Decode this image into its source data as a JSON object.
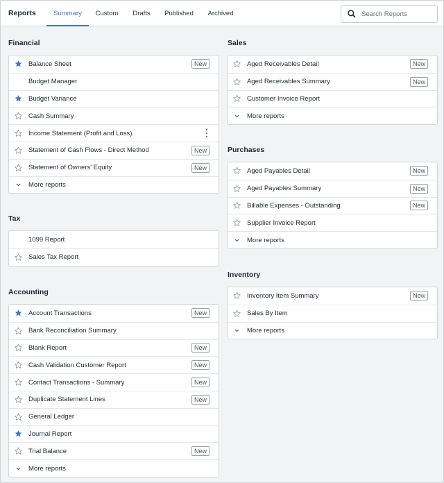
{
  "app": {
    "title": "Reports"
  },
  "tabs": [
    {
      "label": "Summary",
      "active": true
    },
    {
      "label": "Custom",
      "active": false
    },
    {
      "label": "Drafts",
      "active": false
    },
    {
      "label": "Published",
      "active": false
    },
    {
      "label": "Archived",
      "active": false
    }
  ],
  "search": {
    "placeholder": "Search Reports",
    "value": "",
    "icon": "search-icon"
  },
  "colors": {
    "accent": "#3b78c2",
    "star_filled": "#3b78c2",
    "star_outline": "#8a929b"
  },
  "badge_label": "New",
  "sections": {
    "financial": {
      "title": "Financial",
      "items": [
        {
          "label": "Balance Sheet",
          "star": "filled",
          "badge": true
        },
        {
          "label": "Budget Manager",
          "star": "none",
          "badge": false
        },
        {
          "label": "Budget Variance",
          "star": "filled",
          "badge": false
        },
        {
          "label": "Cash Summary",
          "star": "outline",
          "badge": false
        },
        {
          "label": "Income Statement (Profit and Loss)",
          "star": "outline",
          "badge": false,
          "menu": true
        },
        {
          "label": "Statement of Cash Flows - Direct Method",
          "star": "outline",
          "badge": true
        },
        {
          "label": "Statement of Owners' Equity",
          "star": "outline",
          "badge": true
        },
        {
          "label": "More reports",
          "type": "more"
        }
      ]
    },
    "tax": {
      "title": "Tax",
      "items": [
        {
          "label": "1099 Report",
          "star": "none",
          "badge": false
        },
        {
          "label": "Sales Tax Report",
          "star": "outline",
          "badge": false
        }
      ]
    },
    "accounting": {
      "title": "Accounting",
      "items": [
        {
          "label": "Account Transactions",
          "star": "filled",
          "badge": true
        },
        {
          "label": "Bank Reconciliation Summary",
          "star": "outline",
          "badge": false
        },
        {
          "label": "Blank Report",
          "star": "outline",
          "badge": true
        },
        {
          "label": "Cash Validation Customer Report",
          "star": "outline",
          "badge": true
        },
        {
          "label": "Contact Transactions - Summary",
          "star": "outline",
          "badge": true
        },
        {
          "label": "Duplicate Statement Lines",
          "star": "outline",
          "badge": true
        },
        {
          "label": "General Ledger",
          "star": "outline",
          "badge": false
        },
        {
          "label": "Journal Report",
          "star": "filled",
          "badge": false
        },
        {
          "label": "Trial Balance",
          "star": "outline",
          "badge": true
        },
        {
          "label": "More reports",
          "type": "more"
        }
      ]
    },
    "sales": {
      "title": "Sales",
      "items": [
        {
          "label": "Aged Receivables Detail",
          "star": "outline",
          "badge": true
        },
        {
          "label": "Aged Receivables Summary",
          "star": "outline",
          "badge": true
        },
        {
          "label": "Customer Invoice Report",
          "star": "outline",
          "badge": false
        },
        {
          "label": "More reports",
          "type": "more"
        }
      ]
    },
    "purchases": {
      "title": "Purchases",
      "items": [
        {
          "label": "Aged Payables Detail",
          "star": "outline",
          "badge": true
        },
        {
          "label": "Aged Payables Summary",
          "star": "outline",
          "badge": true
        },
        {
          "label": "Billable Expenses - Outstanding",
          "star": "outline",
          "badge": true
        },
        {
          "label": "Supplier Invoice Report",
          "star": "outline",
          "badge": false
        },
        {
          "label": "More reports",
          "type": "more"
        }
      ]
    },
    "inventory": {
      "title": "Inventory",
      "items": [
        {
          "label": "Inventory Item Summary",
          "star": "outline",
          "badge": true
        },
        {
          "label": "Sales By Item",
          "star": "outline",
          "badge": false
        },
        {
          "label": "More reports",
          "type": "more"
        }
      ]
    }
  }
}
